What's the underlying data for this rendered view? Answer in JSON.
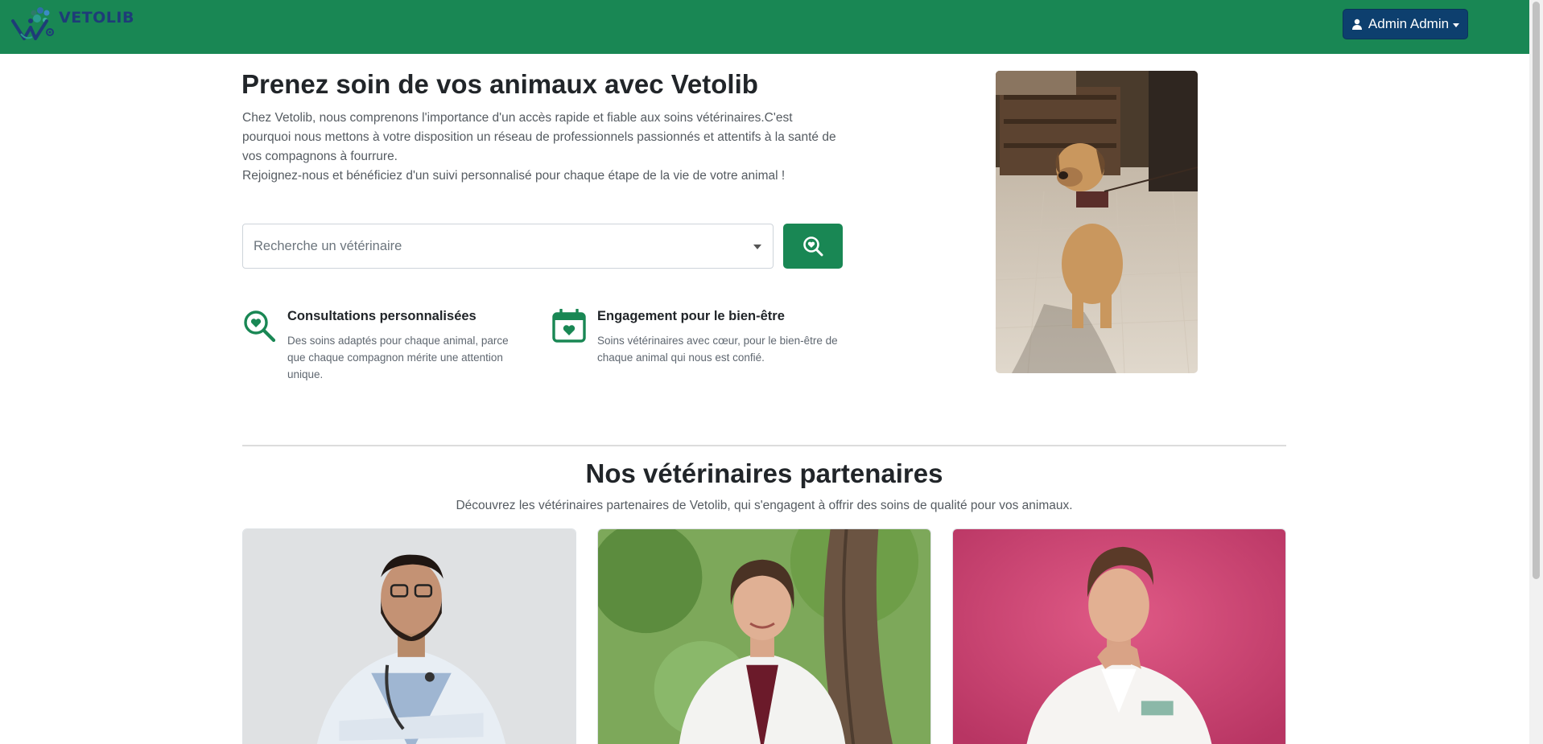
{
  "navbar": {
    "brand": "VETOLIB",
    "user_menu_label": "Admin Admin",
    "color": "#198754"
  },
  "hero": {
    "title": "Prenez soin de vos animaux avec Vetolib",
    "paragraph_1": "Chez Vetolib, nous comprenons l'importance d'un accès rapide et fiable aux soins vétérinaires.C'est pourquoi nous mettons à votre disposition un réseau de professionnels passionnés et attentifs à la santé de vos compagnons à fourrure.",
    "paragraph_2": "Rejoignez-nous et bénéficiez d'un suivi personnalisé pour chaque étape de la vie de votre animal !",
    "search_placeholder": "Recherche un vétérinaire",
    "search_button_icon": "search-heart-icon",
    "image": "dog-photo"
  },
  "features": [
    {
      "icon": "search-heart-icon",
      "title": "Consultations personnalisées",
      "description": "Des soins adaptés pour chaque animal, parce que chaque compagnon mérite une attention unique."
    },
    {
      "icon": "calendar-heart-icon",
      "title": "Engagement pour le bien-être",
      "description": "Soins vétérinaires avec cœur, pour le bien-être de chaque animal qui nous est confié."
    }
  ],
  "partners": {
    "title": "Nos vétérinaires partenaires",
    "subtitle": "Découvrez les vétérinaires partenaires de Vetolib, qui s'engagent à offrir des soins de qualité pour vos animaux.",
    "cards": [
      {
        "image": "vet-photo-1"
      },
      {
        "image": "vet-photo-2"
      },
      {
        "image": "vet-photo-3"
      }
    ]
  },
  "colors": {
    "primary": "#198754",
    "user_button": "#0d3f6e"
  }
}
